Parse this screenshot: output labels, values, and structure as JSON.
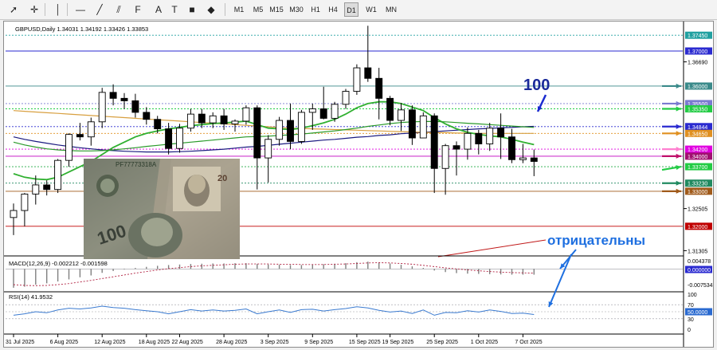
{
  "toolbar": {
    "tools": [
      {
        "name": "cursor-icon",
        "glyph": "➚"
      },
      {
        "name": "crosshair-icon",
        "glyph": "✛"
      },
      {
        "name": "vertical-line-icon",
        "glyph": "│"
      },
      {
        "name": "horizontal-line-icon",
        "glyph": "—"
      },
      {
        "name": "trendline-icon",
        "glyph": "╱"
      },
      {
        "name": "channel-icon",
        "glyph": "⫽"
      },
      {
        "name": "fibonacci-icon",
        "glyph": "F"
      },
      {
        "name": "text-icon",
        "glyph": "A"
      },
      {
        "name": "label-icon",
        "glyph": "T"
      },
      {
        "name": "rectangle-icon",
        "glyph": "■"
      },
      {
        "name": "shapes-icon",
        "glyph": "◆"
      }
    ],
    "timeframes": [
      "M1",
      "M5",
      "M15",
      "M30",
      "H1",
      "H4",
      "D1",
      "W1",
      "MN"
    ],
    "active_timeframe": "D1"
  },
  "chart_header": {
    "symbol_label": "GBPUSD,Daily  1.34031 1.34192 1.33426 1.33853"
  },
  "price_labels": [
    "1.37450",
    "1.37000",
    "1.36690",
    "1.36000",
    "1.35500",
    "1.35350",
    "1.34844",
    "1.34650",
    "1.34200",
    "1.34000",
    "1.33700",
    "1.33230",
    "1.33000",
    "1.32505",
    "1.32000",
    "1.31305"
  ],
  "macd": {
    "label": "MACD(12,26,9) -0.002212 -0.001598",
    "axis_labels": [
      "0.004378",
      "0.000000",
      "-0.007534"
    ]
  },
  "rsi": {
    "label": "RSI(14) 41.9532",
    "axis_labels": [
      "100",
      "70",
      "50.0000",
      "30",
      "0"
    ]
  },
  "date_labels": [
    "31 Jul 2025",
    "6 Aug 2025",
    "12 Aug 2025",
    "18 Aug 2025",
    "22 Aug 2025",
    "28 Aug 2025",
    "3 Sep 2025",
    "9 Sep 2025",
    "15 Sep 2025",
    "19 Sep 2025",
    "25 Sep 2025",
    "1 Oct 2025",
    "7 Oct 2025"
  ],
  "annotations": {
    "ma_period": "100",
    "negative_word": "отрицательны"
  },
  "colors": {
    "accent_blue": "#1e6fe0",
    "label_green": "#22cc44",
    "label_blue": "#2a2ad0",
    "label_magenta": "#e000e0",
    "label_brown": "#a05a1a",
    "label_teal": "#3a8a8a",
    "label_darkred": "#a01020"
  },
  "chart_data": {
    "type": "candlestick",
    "symbol": "GBPUSD",
    "timeframe": "Daily",
    "price_range": [
      1.312,
      1.3775
    ],
    "levels": [
      1.3745,
      1.37,
      1.36,
      1.355,
      1.3535,
      1.34844,
      1.3465,
      1.342,
      1.34,
      1.337,
      1.3323,
      1.33,
      1.32
    ],
    "candles": [
      {
        "o": 1.3225,
        "h": 1.3265,
        "l": 1.3175,
        "c": 1.3245
      },
      {
        "o": 1.3245,
        "h": 1.3295,
        "l": 1.32,
        "c": 1.3292
      },
      {
        "o": 1.3292,
        "h": 1.3345,
        "l": 1.3262,
        "c": 1.3318
      },
      {
        "o": 1.3318,
        "h": 1.3331,
        "l": 1.3288,
        "c": 1.3305
      },
      {
        "o": 1.3305,
        "h": 1.3392,
        "l": 1.3295,
        "c": 1.3388
      },
      {
        "o": 1.3388,
        "h": 1.3465,
        "l": 1.337,
        "c": 1.3462
      },
      {
        "o": 1.3462,
        "h": 1.3495,
        "l": 1.3445,
        "c": 1.3455
      },
      {
        "o": 1.3455,
        "h": 1.351,
        "l": 1.343,
        "c": 1.3498
      },
      {
        "o": 1.3498,
        "h": 1.3595,
        "l": 1.348,
        "c": 1.3582
      },
      {
        "o": 1.3582,
        "h": 1.3605,
        "l": 1.3545,
        "c": 1.3565
      },
      {
        "o": 1.3565,
        "h": 1.358,
        "l": 1.3535,
        "c": 1.3558
      },
      {
        "o": 1.3558,
        "h": 1.3578,
        "l": 1.351,
        "c": 1.3525
      },
      {
        "o": 1.3525,
        "h": 1.354,
        "l": 1.349,
        "c": 1.3505
      },
      {
        "o": 1.3505,
        "h": 1.3515,
        "l": 1.3465,
        "c": 1.3478
      },
      {
        "o": 1.3478,
        "h": 1.3495,
        "l": 1.3405,
        "c": 1.3422
      },
      {
        "o": 1.3422,
        "h": 1.3492,
        "l": 1.341,
        "c": 1.348
      },
      {
        "o": 1.348,
        "h": 1.3535,
        "l": 1.347,
        "c": 1.352
      },
      {
        "o": 1.352,
        "h": 1.3535,
        "l": 1.348,
        "c": 1.3495
      },
      {
        "o": 1.3495,
        "h": 1.3525,
        "l": 1.348,
        "c": 1.3515
      },
      {
        "o": 1.3515,
        "h": 1.3535,
        "l": 1.3475,
        "c": 1.3492
      },
      {
        "o": 1.3492,
        "h": 1.3505,
        "l": 1.347,
        "c": 1.35
      },
      {
        "o": 1.35,
        "h": 1.3545,
        "l": 1.349,
        "c": 1.3538
      },
      {
        "o": 1.3538,
        "h": 1.3545,
        "l": 1.3305,
        "c": 1.3395
      },
      {
        "o": 1.3395,
        "h": 1.346,
        "l": 1.3325,
        "c": 1.3448
      },
      {
        "o": 1.3448,
        "h": 1.3512,
        "l": 1.343,
        "c": 1.3502
      },
      {
        "o": 1.3502,
        "h": 1.355,
        "l": 1.342,
        "c": 1.3442
      },
      {
        "o": 1.3442,
        "h": 1.3532,
        "l": 1.3435,
        "c": 1.3525
      },
      {
        "o": 1.3525,
        "h": 1.355,
        "l": 1.3475,
        "c": 1.3535
      },
      {
        "o": 1.3535,
        "h": 1.3598,
        "l": 1.3505,
        "c": 1.3508
      },
      {
        "o": 1.3508,
        "h": 1.3555,
        "l": 1.3498,
        "c": 1.3548
      },
      {
        "o": 1.3548,
        "h": 1.3592,
        "l": 1.3535,
        "c": 1.3585
      },
      {
        "o": 1.3585,
        "h": 1.3662,
        "l": 1.3575,
        "c": 1.3652
      },
      {
        "o": 1.3652,
        "h": 1.3772,
        "l": 1.3612,
        "c": 1.3622
      },
      {
        "o": 1.3622,
        "h": 1.3652,
        "l": 1.3505,
        "c": 1.3565
      },
      {
        "o": 1.3565,
        "h": 1.3572,
        "l": 1.3488,
        "c": 1.3502
      },
      {
        "o": 1.3502,
        "h": 1.3552,
        "l": 1.3472,
        "c": 1.3532
      },
      {
        "o": 1.3532,
        "h": 1.3545,
        "l": 1.3432,
        "c": 1.3452
      },
      {
        "o": 1.3452,
        "h": 1.3525,
        "l": 1.3455,
        "c": 1.3515
      },
      {
        "o": 1.3515,
        "h": 1.3522,
        "l": 1.3295,
        "c": 1.3365
      },
      {
        "o": 1.3365,
        "h": 1.3435,
        "l": 1.329,
        "c": 1.343
      },
      {
        "o": 1.343,
        "h": 1.3442,
        "l": 1.3345,
        "c": 1.342
      },
      {
        "o": 1.342,
        "h": 1.3482,
        "l": 1.339,
        "c": 1.3465
      },
      {
        "o": 1.3465,
        "h": 1.3475,
        "l": 1.3405,
        "c": 1.3435
      },
      {
        "o": 1.3435,
        "h": 1.3495,
        "l": 1.3415,
        "c": 1.348
      },
      {
        "o": 1.348,
        "h": 1.3522,
        "l": 1.3392,
        "c": 1.3455
      },
      {
        "o": 1.3455,
        "h": 1.3478,
        "l": 1.338,
        "c": 1.339
      },
      {
        "o": 1.339,
        "h": 1.3435,
        "l": 1.338,
        "c": 1.3395
      },
      {
        "o": 1.3395,
        "h": 1.3419,
        "l": 1.3343,
        "c": 1.3385
      }
    ],
    "moving_averages": [
      {
        "name": "MA100",
        "color": "#1a1a80",
        "values": [
          1.3455,
          1.3448,
          1.3442,
          1.3437,
          1.3432,
          1.3428,
          1.3424,
          1.3421,
          1.3418,
          1.3416,
          1.3414,
          1.3413,
          1.3412,
          1.3412,
          1.3412,
          1.3413,
          1.3414,
          1.3416,
          1.3418,
          1.342,
          1.3423,
          1.3426,
          1.3428,
          1.3431,
          1.3434,
          1.3437,
          1.344,
          1.3443,
          1.3446,
          1.3448,
          1.3451,
          1.3454,
          1.3456,
          1.3459,
          1.3461,
          1.3464,
          1.3466,
          1.3468,
          1.347,
          1.3472,
          1.3474,
          1.3476,
          1.3478,
          1.3479,
          1.3481,
          1.3482,
          1.3484,
          1.3485
        ]
      },
      {
        "name": "MA200",
        "color": "#d8a040",
        "values": [
          1.353,
          1.3528,
          1.3526,
          1.3524,
          1.3522,
          1.352,
          1.3518,
          1.3516,
          1.3514,
          1.3512,
          1.351,
          1.3508,
          1.3506,
          1.3504,
          1.3502,
          1.35,
          1.3498,
          1.3496,
          1.3494,
          1.3492,
          1.349,
          1.3488,
          1.3486,
          1.3484,
          1.3482,
          1.348,
          1.3479,
          1.3478,
          1.3477,
          1.3476,
          1.3475,
          1.3474,
          1.3473,
          1.3472,
          1.3471,
          1.347,
          1.3469,
          1.3468,
          1.3467,
          1.3467,
          1.3466,
          1.3466,
          1.3465,
          1.3465,
          1.3465,
          1.3465,
          1.3465,
          1.3465
        ]
      },
      {
        "name": "MA20",
        "color": "#30b030",
        "values": [
          1.335,
          1.334,
          1.3335,
          1.3333,
          1.334,
          1.3355,
          1.337,
          1.3385,
          1.3405,
          1.3425,
          1.344,
          1.3455,
          1.3465,
          1.3472,
          1.3478,
          1.3482,
          1.3487,
          1.349,
          1.3493,
          1.3495,
          1.3497,
          1.35,
          1.349,
          1.348,
          1.3478,
          1.3476,
          1.348,
          1.3487,
          1.3495,
          1.3505,
          1.352,
          1.3538,
          1.355,
          1.3555,
          1.3555,
          1.355,
          1.354,
          1.353,
          1.351,
          1.3492,
          1.3478,
          1.3468,
          1.3462,
          1.3458,
          1.3455,
          1.3448,
          1.344,
          1.3433
        ]
      },
      {
        "name": "MA50",
        "color": "#2a9a2a",
        "values": [
          1.344,
          1.3432,
          1.3426,
          1.3421,
          1.3418,
          1.3416,
          1.3415,
          1.3415,
          1.3416,
          1.3418,
          1.3421,
          1.3424,
          1.3428,
          1.3431,
          1.3434,
          1.3437,
          1.344,
          1.3443,
          1.3446,
          1.3449,
          1.3452,
          1.3455,
          1.3456,
          1.3457,
          1.3459,
          1.3461,
          1.3463,
          1.3466,
          1.3469,
          1.3472,
          1.3476,
          1.348,
          1.3485,
          1.3489,
          1.3493,
          1.3496,
          1.3498,
          1.3499,
          1.3499,
          1.3498,
          1.3496,
          1.3494,
          1.3492,
          1.349,
          1.3488,
          1.3486,
          1.3484,
          1.3482
        ]
      }
    ],
    "macd": {
      "range": [
        -0.007534,
        0.004378
      ],
      "histogram": [
        -0.0072,
        -0.0068,
        -0.006,
        -0.0055,
        -0.0048,
        -0.004,
        -0.0032,
        -0.0025,
        -0.0015,
        -0.0008,
        -0.0002,
        0.0004,
        0.0008,
        0.0012,
        0.0015,
        0.0017,
        0.0019,
        0.002,
        0.0021,
        0.0021,
        0.0022,
        0.0022,
        0.0019,
        0.0017,
        0.0016,
        0.0015,
        0.0015,
        0.0016,
        0.0018,
        0.002,
        0.0022,
        0.0026,
        0.0028,
        0.0025,
        0.0021,
        0.0016,
        0.001,
        0.0004,
        -0.0006,
        -0.0012,
        -0.0016,
        -0.0018,
        -0.0019,
        -0.002,
        -0.0021,
        -0.0022,
        -0.0022,
        -0.0022
      ],
      "signal": [
        -0.006,
        -0.0063,
        -0.0064,
        -0.0063,
        -0.006,
        -0.0056,
        -0.005,
        -0.0044,
        -0.0037,
        -0.003,
        -0.0023,
        -0.0016,
        -0.001,
        -0.0004,
        0.0001,
        0.0005,
        0.0009,
        0.0012,
        0.0014,
        0.0016,
        0.0018,
        0.0019,
        0.0019,
        0.0019,
        0.0018,
        0.0018,
        0.0017,
        0.0017,
        0.0017,
        0.0018,
        0.0019,
        0.0021,
        0.0023,
        0.0024,
        0.0023,
        0.0021,
        0.0018,
        0.0014,
        0.0009,
        0.0004,
        0.0,
        -0.0004,
        -0.0007,
        -0.001,
        -0.0012,
        -0.0014,
        -0.0015,
        -0.0016
      ]
    },
    "rsi": {
      "range": [
        0,
        100
      ],
      "levels": [
        70,
        50,
        30
      ],
      "values": [
        40,
        44,
        50,
        47,
        55,
        60,
        58,
        61,
        66,
        62,
        60,
        56,
        53,
        50,
        44,
        50,
        56,
        52,
        55,
        52,
        54,
        58,
        44,
        50,
        55,
        48,
        56,
        57,
        52,
        56,
        59,
        64,
        61,
        54,
        49,
        52,
        45,
        55,
        40,
        48,
        47,
        53,
        49,
        55,
        51,
        45,
        46,
        41.9532
      ]
    }
  }
}
